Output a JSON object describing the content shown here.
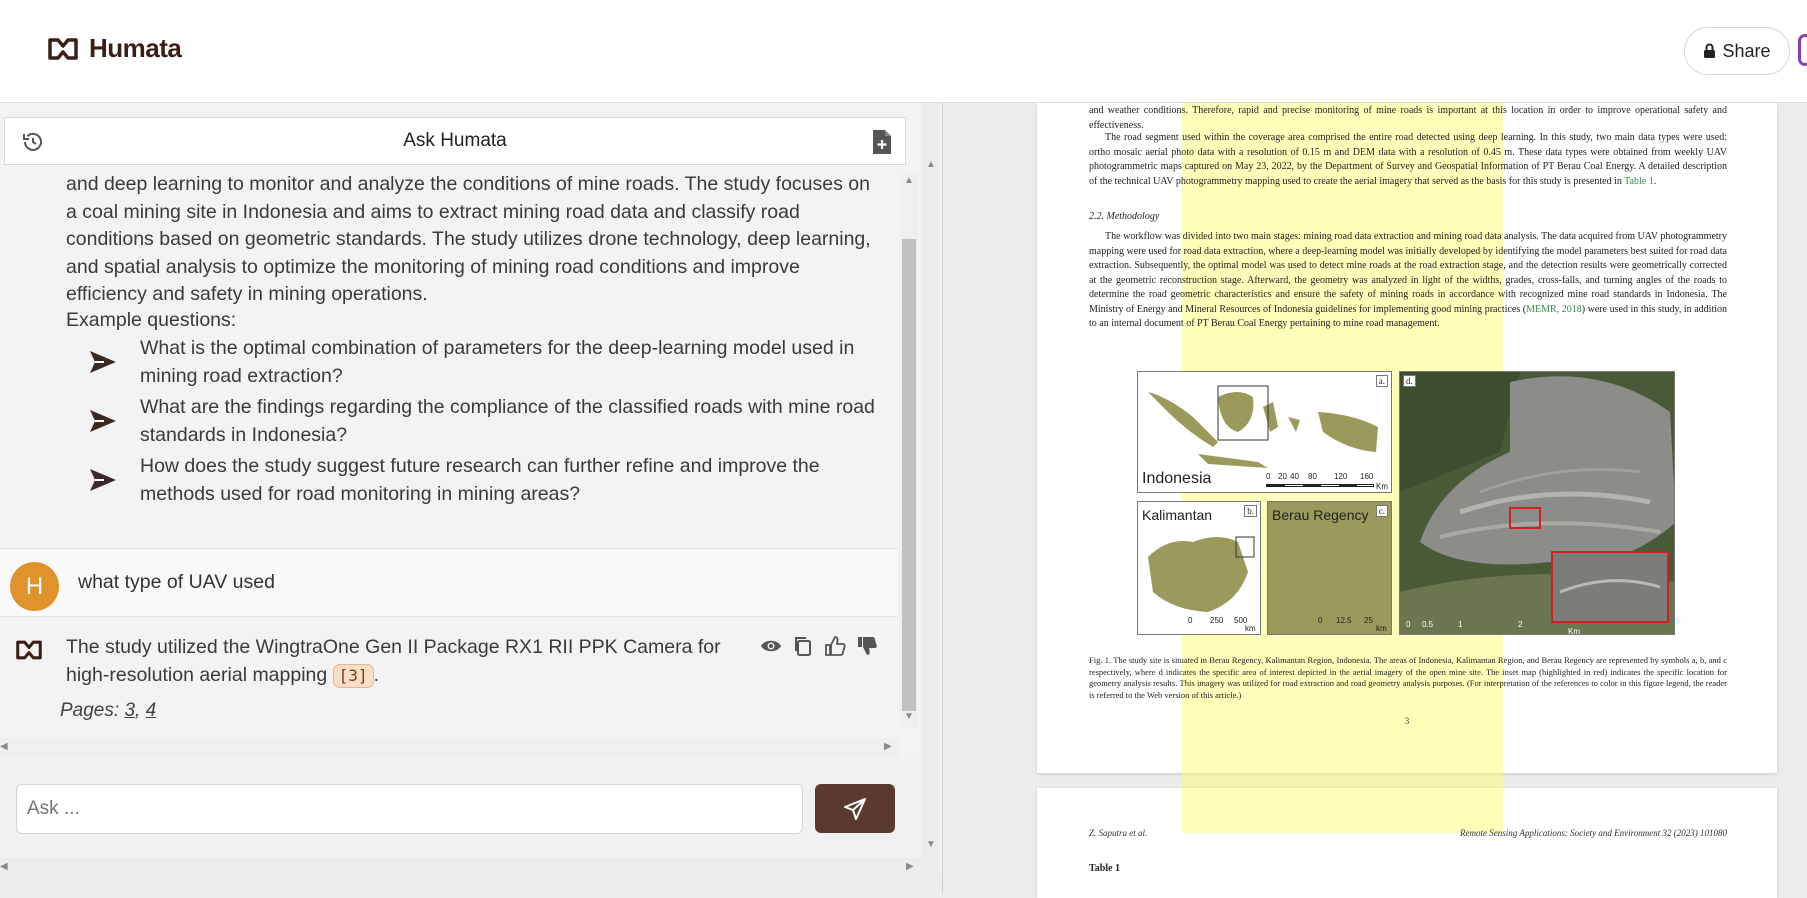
{
  "header": {
    "brand": "Humata",
    "share_label": "Share"
  },
  "chat": {
    "title": "Ask Humata",
    "summary": "and deep learning to monitor and analyze the conditions of mine roads. The study focuses on a coal mining site in Indonesia and aims to extract mining road data and classify road conditions based on geometric standards. The study utilizes drone technology, deep learning, and spatial analysis to optimize the monitoring of mining road conditions and improve efficiency and safety in mining operations.",
    "example_heading": "Example questions:",
    "questions": [
      "What is the optimal combination of parameters for the deep-learning model used in mining road extraction?",
      "What are the findings regarding the compliance of the classified roads with mine road standards in Indonesia?",
      "How does the study suggest future research can further refine and improve the methods used for road monitoring in mining areas?"
    ],
    "user": {
      "avatar": "H",
      "message": "what type of UAV used"
    },
    "bot": {
      "answer": "The study utilized the WingtraOne Gen II Package RX1 RII PPK Camera for high-resolution aerial mapping",
      "citation": "[3]",
      "after": ".",
      "pages_label": "Pages:",
      "page_links": [
        "3",
        "4"
      ]
    },
    "input_placeholder": "Ask ..."
  },
  "pdf": {
    "p1_para1": "and weather conditions. Therefore, rapid and precise monitoring of mine roads is important at this location in order to improve operational safety and effectiveness.",
    "p1_para2": "The road segment used within the coverage area comprised the entire road detected using deep learning. In this study, two main data types were used: ortho mosaic aerial photo data with a resolution of 0.15 m and DEM data with a resolution of 0.45 m. These data types were obtained from weekly UAV photogrammetric maps captured on May 23, 2022, by the Department of Survey and Geospatial Information of PT Berau Coal Energy. A detailed description of the technical UAV photogrammetry mapping used to create the aerial imagery that served as the basis for this study is presented in",
    "p1_para2_ref": "Table 1",
    "section_heading": "2.2.  Methodology",
    "p1_para3a": "The workflow was divided into two main stages: mining road data extraction and mining road data analysis. The data acquired from UAV photogrammetry mapping were used for road data extraction, where a deep-learning model was initially developed by identifying the model parameters best suited for road data extraction. Subsequently, the optimal model was used to detect mine roads at the road extraction stage, and the detection results were geometrically corrected at the geometric reconstruction stage. Afterward, the geometry was analyzed in light of the widths, grades, cross-falls, and turning angles of the roads to determine the road geometric characteristics and ensure the safety of mining roads in accordance with recognized mine road standards in Indonesia. The Ministry of Energy and Mineral Resources of Indonesia guidelines for implementing good mining practices (",
    "p1_para3_ref": "MEMR, 2018",
    "p1_para3b": ") were used in this study, in addition to an internal document of PT Berau Coal Energy pertaining to mine road management.",
    "map_labels": {
      "a": "Indonesia",
      "b": "Kalimantan",
      "c": "Berau Regency"
    },
    "map_corners": {
      "a": "a.",
      "b": "b.",
      "c": "c.",
      "d": "d."
    },
    "scale_a": [
      "0",
      "20",
      "40",
      "80",
      "120",
      "160",
      "Km"
    ],
    "scale_b": [
      "0",
      "250",
      "500",
      "km"
    ],
    "scale_c": [
      "0",
      "12.5",
      "25",
      "km"
    ],
    "scale_d": [
      "0",
      "0.5",
      "1",
      "2",
      "Km"
    ],
    "caption": "Fig. 1. The study site is situated in Berau Regency, Kalimantan Region, Indonesia. The areas of Indonesia, Kalimantan Region, and Berau Regency are represented by symbols a, b, and c respectively, where d indicates the specific area of interest depicted in the aerial imagery of the open mine site. The inset map (highlighted in red) indicates the specific location for geometry analysis results. This imagery was utilized for road extraction and road geometry analysis purposes. (For interpretation of the references to color in this figure legend, the reader is referred to the Web version of this article.)",
    "page_number": "3",
    "p2_left_header": "Z. Saputra et al.",
    "p2_right_header": "Remote Sensing Applications: Society and Environment 32 (2023) 101080",
    "p2_table": "Table 1"
  }
}
